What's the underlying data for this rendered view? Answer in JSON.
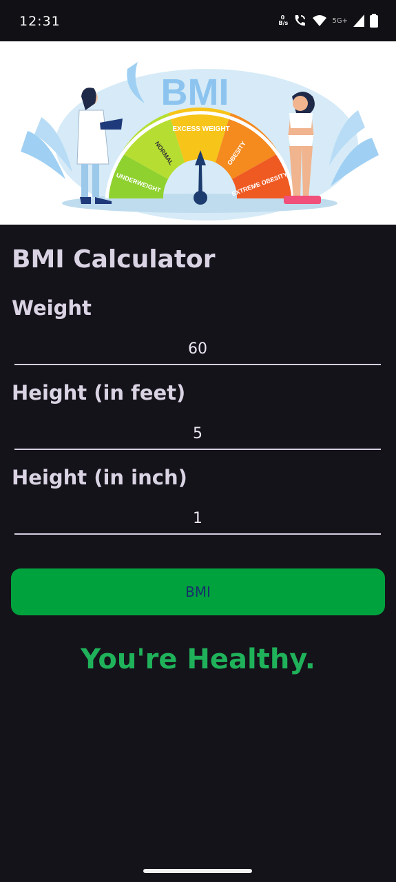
{
  "status_bar": {
    "time": "12:31",
    "net_speed_top": "0",
    "net_speed_bottom": "B/s",
    "network_type": "5G+"
  },
  "banner": {
    "heading": "BMI",
    "segments": [
      "UNDERWEIGHT",
      "NORMAL",
      "EXCESS WEIGHT",
      "OBESITY",
      "EXTREME OBESITY"
    ]
  },
  "form": {
    "title": "BMI Calculator",
    "weight_label": "Weight",
    "weight_value": "60",
    "height_feet_label": "Height (in feet)",
    "height_feet_value": "5",
    "height_inch_label": "Height (in inch)",
    "height_inch_value": "1",
    "button_label": "BMI",
    "result_text": "You're Healthy."
  },
  "colors": {
    "background": "#15131a",
    "button": "#00a23e",
    "result": "#1fb25a"
  }
}
